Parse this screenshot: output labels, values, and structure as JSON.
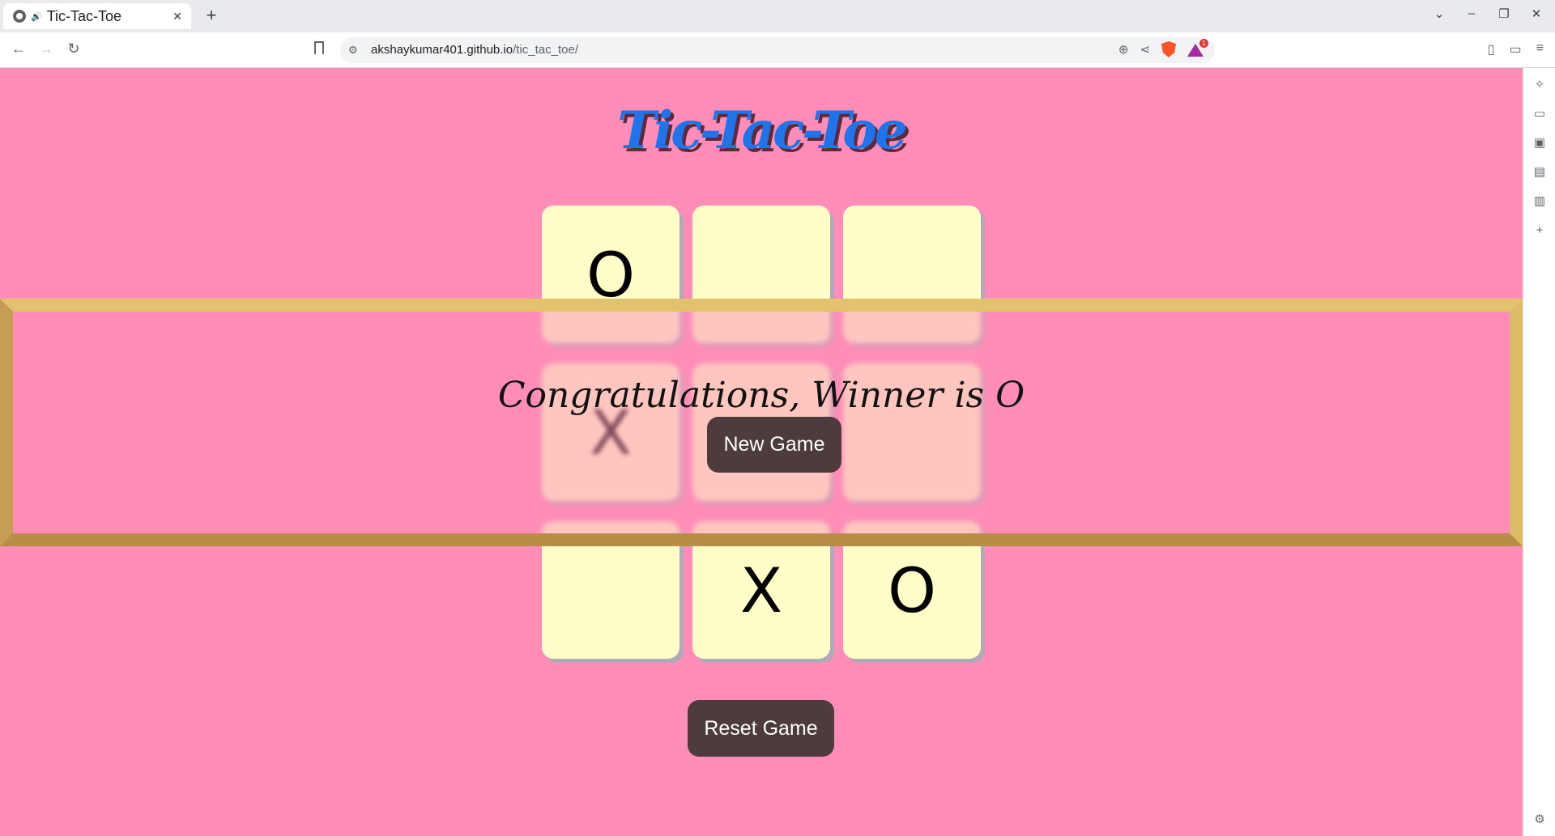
{
  "browser": {
    "tab_title": "Tic-Tac-Toe",
    "new_tab_label": "+",
    "url_domain": "akshaykumar401.github.io",
    "url_path": "/tic_tac_toe/",
    "rewards_badge": "1"
  },
  "page": {
    "heading": "Tic-Tac-Toe",
    "board": [
      "O",
      "",
      "",
      "X",
      "",
      "",
      "",
      "X",
      "O"
    ],
    "win_message": "Congratulations, Winner is O",
    "new_game_label": "New Game",
    "reset_label": "Reset Game"
  },
  "colors": {
    "page_background": "#ff8db8",
    "heading": "#1e74e8",
    "cell": "#fffec8",
    "button": "#4d3b3d",
    "win_border": "#cfa658"
  }
}
